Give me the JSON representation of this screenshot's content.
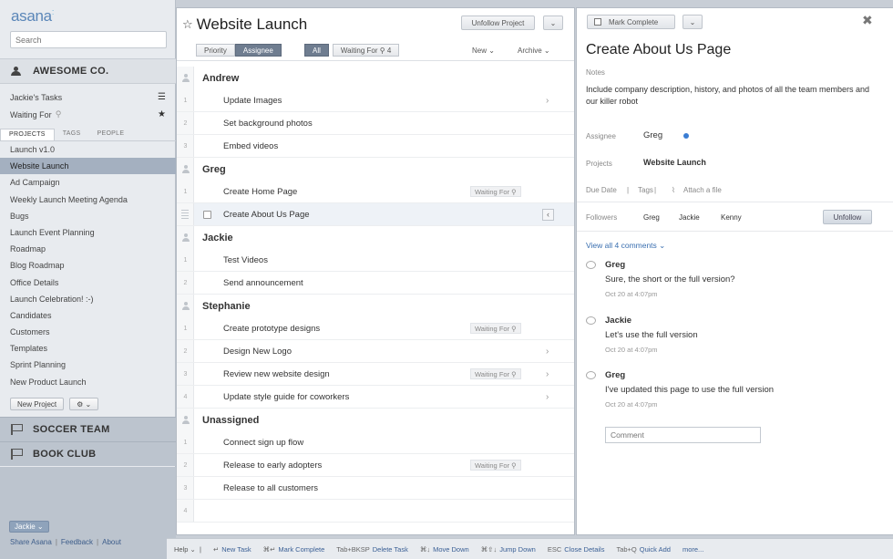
{
  "sidebar": {
    "logo": "asana",
    "search_placeholder": "Search",
    "workspace": "AWESOME CO.",
    "my_tasks": "Jackie's Tasks",
    "waiting_for": "Waiting For",
    "tabs": [
      "PROJECTS",
      "TAGS",
      "PEOPLE"
    ],
    "projects": [
      "Launch v1.0",
      "Website Launch",
      "Ad Campaign",
      "Weekly Launch Meeting Agenda",
      "Bugs",
      "Launch Event Planning",
      "Roadmap",
      "Blog Roadmap",
      "Office Details",
      "Launch Celebration! :-)",
      "Candidates",
      "Customers",
      "Templates",
      "Sprint Planning",
      "New Product Launch"
    ],
    "new_project": "New Project",
    "other_workspaces": [
      "SOCCER TEAM",
      "BOOK CLUB"
    ],
    "user": "Jackie",
    "footer_links": [
      "Share Asana",
      "Feedback",
      "About"
    ]
  },
  "task_pane": {
    "title": "Website Launch",
    "unfollow_project": "Unfollow Project",
    "sort_buttons": [
      "Priority",
      "Assignee"
    ],
    "filter_all": "All",
    "filter_waiting": "Waiting For",
    "filter_waiting_count": "4",
    "new_label": "New",
    "archive_label": "Archive",
    "sections": [
      {
        "name": "Andrew",
        "tasks": [
          {
            "num": "1",
            "name": "Update Images",
            "chevron": true
          },
          {
            "num": "2",
            "name": "Set background photos"
          },
          {
            "num": "3",
            "name": "Embed videos"
          }
        ]
      },
      {
        "name": "Greg",
        "tasks": [
          {
            "num": "1",
            "name": "Create Home Page",
            "waiting": "Waiting For"
          },
          {
            "num": "",
            "name": "Create About Us Page",
            "selected": true
          }
        ]
      },
      {
        "name": "Jackie",
        "tasks": [
          {
            "num": "1",
            "name": "Test Videos"
          },
          {
            "num": "2",
            "name": "Send announcement"
          }
        ]
      },
      {
        "name": "Stephanie",
        "tasks": [
          {
            "num": "1",
            "name": "Create prototype designs",
            "waiting": "Waiting For"
          },
          {
            "num": "2",
            "name": "Design New Logo",
            "chevron": true
          },
          {
            "num": "3",
            "name": "Review new website design",
            "waiting": "Waiting For",
            "chevron": true
          },
          {
            "num": "4",
            "name": "Update style guide for coworkers",
            "chevron": true
          }
        ]
      },
      {
        "name": "Unassigned",
        "tasks": [
          {
            "num": "1",
            "name": "Connect sign up flow"
          },
          {
            "num": "2",
            "name": "Release to early adopters",
            "waiting": "Waiting For"
          },
          {
            "num": "3",
            "name": "Release to all customers"
          },
          {
            "num": "4",
            "name": ""
          }
        ]
      }
    ]
  },
  "details": {
    "mark_complete": "Mark Complete",
    "title": "Create About Us Page",
    "notes_label": "Notes",
    "notes": "Include company description, history, and photos of all the team members and our killer robot",
    "assignee_label": "Assignee",
    "assignee": "Greg",
    "projects_label": "Projects",
    "project": "Website Launch",
    "due_date": "Due Date",
    "tags": "Tags",
    "attach": "Attach a file",
    "followers_label": "Followers",
    "followers": [
      "Greg",
      "Jackie",
      "Kenny"
    ],
    "unfollow": "Unfollow",
    "view_all": "View all 4 comments",
    "comments": [
      {
        "author": "Greg",
        "text": "Sure, the short or the full version?",
        "time": "Oct 20 at 4:07pm"
      },
      {
        "author": "Jackie",
        "text": "Let's use the full version",
        "time": "Oct 20 at 4:07pm"
      },
      {
        "author": "Greg",
        "text": "I've updated this page to use the full version",
        "time": "Oct 20 at 4:07pm"
      }
    ],
    "comment_placeholder": "Comment"
  },
  "shortcuts": {
    "help": "Help",
    "items": [
      {
        "key": "↵",
        "action": "New Task"
      },
      {
        "key": "⌘↵",
        "action": "Mark Complete"
      },
      {
        "key": "Tab+BKSP",
        "action": "Delete Task"
      },
      {
        "key": "⌘↓",
        "action": "Move Down"
      },
      {
        "key": "⌘⇧↓",
        "action": "Jump Down"
      },
      {
        "key": "ESC",
        "action": "Close Details"
      },
      {
        "key": "Tab+Q",
        "action": "Quick Add"
      }
    ],
    "more": "more..."
  }
}
